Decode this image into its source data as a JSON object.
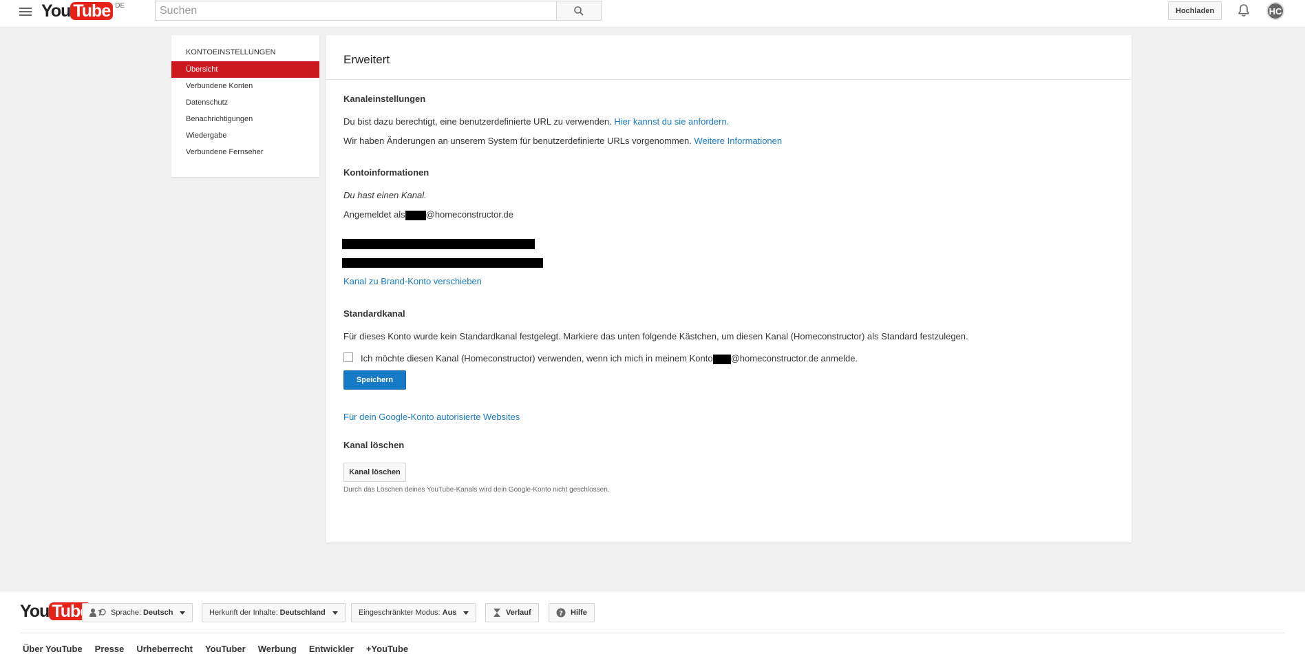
{
  "header": {
    "logo_you": "You",
    "logo_tube": "Tube",
    "region": "DE",
    "search_placeholder": "Suchen",
    "upload_label": "Hochladen",
    "avatar_initials": "HC"
  },
  "sidebar": {
    "title": "KONTOEINSTELLUNGEN",
    "items": [
      {
        "label": "Übersicht",
        "active": true
      },
      {
        "label": "Verbundene Konten"
      },
      {
        "label": "Datenschutz"
      },
      {
        "label": "Benachrichtigungen"
      },
      {
        "label": "Wiedergabe"
      },
      {
        "label": "Verbundene Fernseher"
      }
    ]
  },
  "main": {
    "title": "Erweitert",
    "channel_settings": {
      "heading": "Kanaleinstellungen",
      "custom_url_text": "Du bist dazu berechtigt, eine benutzerdefinierte URL zu verwenden.",
      "custom_url_link": "Hier kannst du sie anfordern.",
      "changes_text": "Wir haben Änderungen an unserem System für benutzerdefinierte URLs vorgenommen.",
      "changes_link": "Weitere Informationen"
    },
    "account_info": {
      "heading": "Kontoinformationen",
      "has_channel": "Du hast einen Kanal.",
      "signed_in_prefix": "Angemeldet als",
      "signed_in_domain": "@homeconstructor.de",
      "move_link": "Kanal zu Brand-Konto verschieben"
    },
    "default_channel": {
      "heading": "Standardkanal",
      "description": "Für dieses Konto wurde kein Standardkanal festgelegt. Markiere das unten folgende Kästchen, um diesen Kanal (Homeconstructor) als Standard festzulegen.",
      "checkbox_prefix": "Ich möchte diesen Kanal (Homeconstructor) verwenden, wenn ich mich in meinem Konto",
      "checkbox_suffix": "@homeconstructor.de anmelde.",
      "checked": false,
      "save_label": "Speichern"
    },
    "authorized_sites_link": "Für dein Google-Konto autorisierte Websites",
    "delete_channel": {
      "heading": "Kanal löschen",
      "button_label": "Kanal löschen",
      "note": "Durch das Löschen deines YouTube-Kanals wird dein Google-Konto nicht geschlossen."
    }
  },
  "footer": {
    "logo_you": "You",
    "logo_tube": "Tube",
    "language_label": "Sprache:",
    "language_value": "Deutsch",
    "location_label": "Herkunft der Inhalte:",
    "location_value": "Deutschland",
    "restricted_label": "Eingeschränkter Modus:",
    "restricted_value": "Aus",
    "history_label": "Verlauf",
    "help_label": "Hilfe",
    "links": [
      "Über YouTube",
      "Presse",
      "Urheberrecht",
      "YouTuber",
      "Werbung",
      "Entwickler",
      "+YouTube"
    ]
  },
  "colors": {
    "accent_red": "#cc181e",
    "link_blue": "#167ac6",
    "button_blue": "#167ac6"
  }
}
